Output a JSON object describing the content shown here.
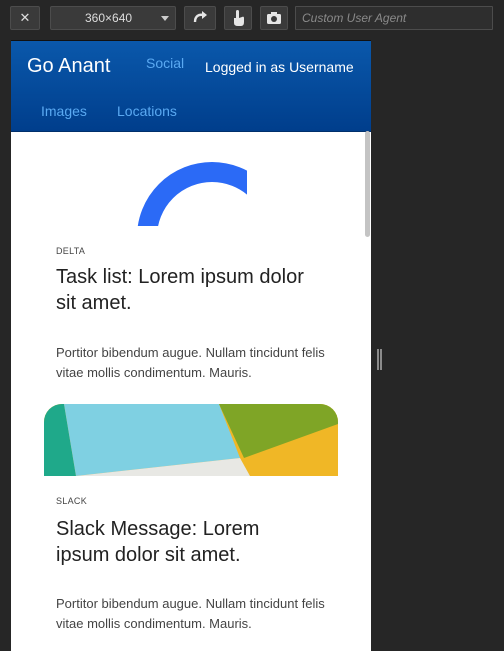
{
  "toolbar": {
    "close_label": "✕",
    "device_size": "360×640",
    "user_agent_placeholder": "Custom User Agent"
  },
  "navbar": {
    "brand": "Go Anant",
    "social": "Social",
    "user": "Logged in as Username",
    "images": "Images",
    "locations": "Locations"
  },
  "cards": [
    {
      "tag": "DELTA",
      "title": "Task list: Lorem ipsum dolor sit amet.",
      "text": "Portitor bibendum augue. Nullam tincidunt felis vitae mollis condimentum. Mauris."
    },
    {
      "tag": "SLACK",
      "title": "Slack Message: Lorem ipsum dolor sit amet.",
      "text": "Portitor bibendum augue. Nullam tincidunt felis vitae mollis condimentum. Mauris."
    }
  ],
  "colors": {
    "navbar": "#0a58ab",
    "accent_link": "#5aa9f2",
    "delta_blue": "#2b6af6"
  }
}
